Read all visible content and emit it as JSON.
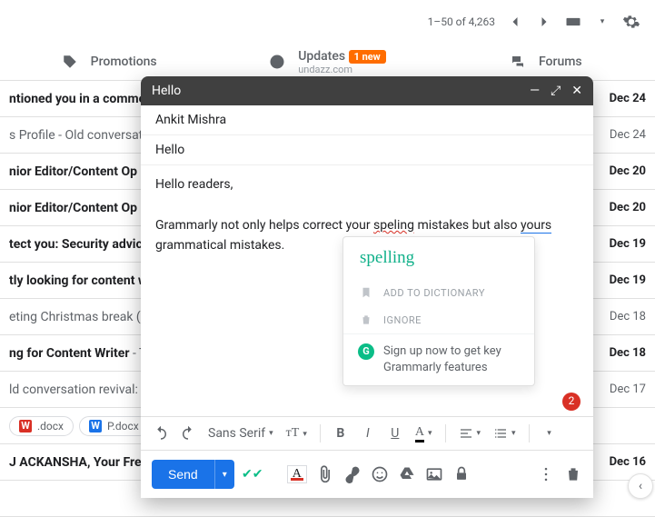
{
  "toolbar": {
    "range": "1–50 of 4,263"
  },
  "tabs": {
    "promotions": "Promotions",
    "updates": {
      "label": "Updates",
      "badge": "1 new",
      "sub": "undazz.com"
    },
    "forums": "Forums"
  },
  "rows": [
    {
      "subject": "ntioned you in a commen",
      "snippet": "",
      "date": "Dec 24",
      "read": false
    },
    {
      "subject": "s Profile - ",
      "snippet": "Old conversati",
      "date": "Dec 24",
      "read": true
    },
    {
      "subject": "nior Editor/Content Op",
      "snippet": "",
      "date": "Dec 20",
      "read": false
    },
    {
      "subject": "nior Editor/Content Op",
      "snippet": "",
      "date": "Dec 20",
      "read": false
    },
    {
      "subject": "tect you: Security advic",
      "snippet": "",
      "date": "Dec 19",
      "read": false
    },
    {
      "subject": "tly looking for content w",
      "snippet": "",
      "date": "Dec 19",
      "read": false
    },
    {
      "subject": "eting Christmas break (",
      "snippet": "",
      "date": "Dec 18",
      "read": true
    },
    {
      "subject": "ng for Content Writer",
      "snippet": " - T",
      "date": "Dec 18",
      "read": false
    },
    {
      "subject": "ld conversation revival:",
      "snippet": "",
      "date": "Dec 17",
      "read": true
    },
    {
      "subject": "",
      "snippet": "",
      "date": "",
      "read": true,
      "chips": [
        ".docx",
        "P.docx"
      ]
    },
    {
      "subject": "J ACKANSHA, Your Free",
      "snippet": "",
      "date": "Dec 16",
      "read": false
    },
    {
      "subject": " ",
      "snippet": "",
      "date": "",
      "read": false
    }
  ],
  "compose": {
    "title": "Hello",
    "to": "Ankit Mishra",
    "subject": "Hello",
    "body": {
      "line1": "Hello readers,",
      "line2a": "Grammarly not only helps correct your ",
      "err": "speling",
      "line2b": " mistakes but also ",
      "err2": "yours",
      "line3": "grammatical mistakes."
    },
    "badge": "2",
    "font": "Sans Serif",
    "send": "Send"
  },
  "grammarly": {
    "suggestion": "spelling",
    "add": "ADD TO DICTIONARY",
    "ignore": "IGNORE",
    "signup": "Sign up now to get key Grammarly features"
  }
}
